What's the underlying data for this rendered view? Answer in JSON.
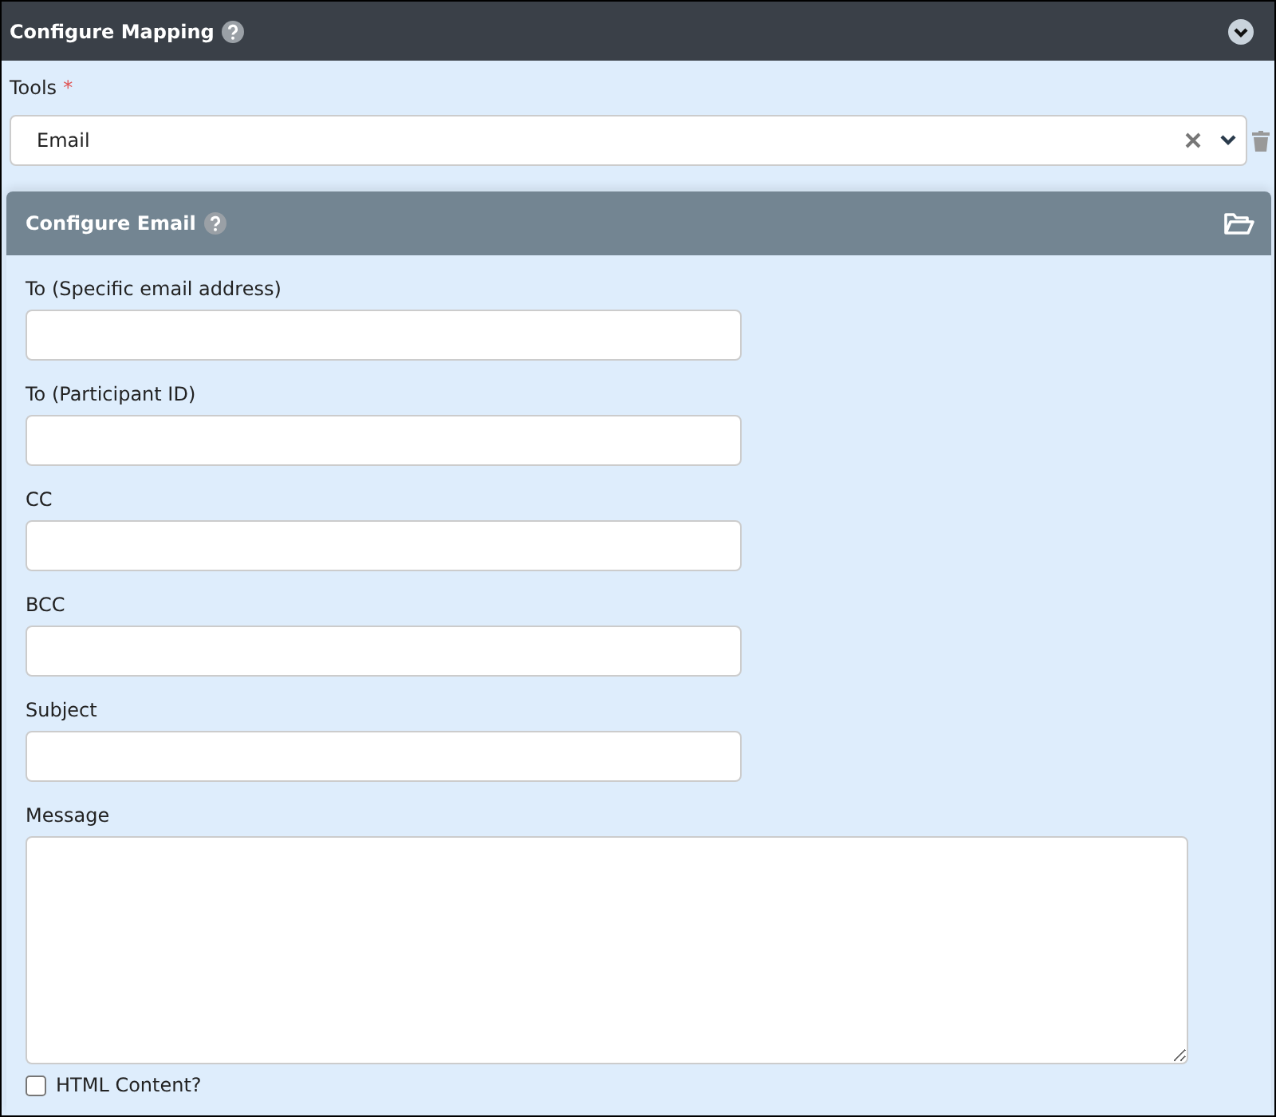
{
  "panel": {
    "title": "Configure Mapping"
  },
  "tools": {
    "label": "Tools",
    "required_mark": "*",
    "value": "Email"
  },
  "subpanel": {
    "title": "Configure Email"
  },
  "fields": [
    {
      "kind": "text",
      "label": "To (Specific email address)"
    },
    {
      "kind": "text",
      "label": "To (Participant ID)"
    },
    {
      "kind": "text",
      "label": "CC"
    },
    {
      "kind": "text",
      "label": "BCC"
    },
    {
      "kind": "text",
      "label": "Subject"
    },
    {
      "kind": "textarea",
      "label": "Message"
    },
    {
      "kind": "checkbox",
      "label": "HTML Content?",
      "checked": false
    }
  ]
}
